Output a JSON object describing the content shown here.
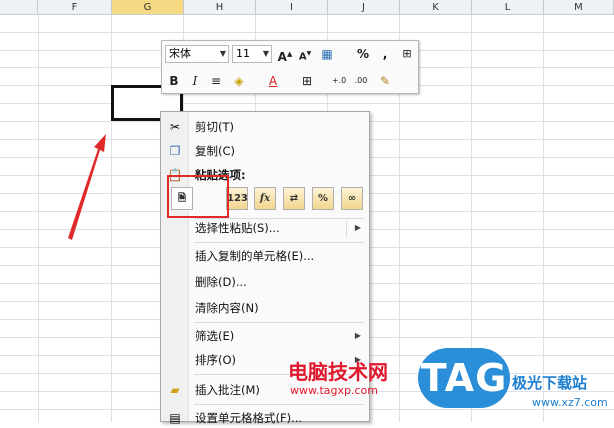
{
  "columns": [
    "F",
    "G",
    "H",
    "I",
    "J",
    "K",
    "L",
    "M"
  ],
  "mini_toolbar": {
    "font_name": "宋体",
    "font_size": "11",
    "percent": "%",
    "comma": ","
  },
  "context_menu": {
    "cut": "剪切(T)",
    "copy": "复制(C)",
    "paste_options": "粘贴选项:",
    "paste_special": "选择性粘贴(S)...",
    "insert_copied": "插入复制的单元格(E)...",
    "delete": "删除(D)...",
    "clear": "清除内容(N)",
    "filter": "筛选(E)",
    "sort": "排序(O)",
    "insert_comment": "插入批注(M)",
    "format_cells": "设置单元格格式(F)..."
  },
  "watermark": {
    "site_name": "电脑技术网",
    "site_url": "www.tagxp.com",
    "tag": "TAG",
    "right_name": "极光下载站",
    "right_url": "www.xz7.com"
  },
  "colors": {
    "highlight_red": "#e02a2a",
    "selected_col": "#f5d983",
    "tag_blue": "#2a8ed8"
  }
}
